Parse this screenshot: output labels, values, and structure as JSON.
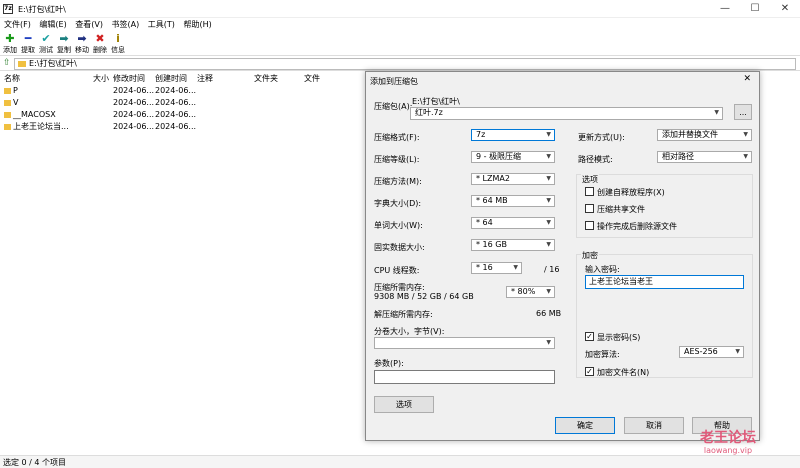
{
  "window": {
    "icon_text": "7z",
    "title": "E:\\打包\\红叶\\"
  },
  "menu": [
    "文件(F)",
    "编辑(E)",
    "查看(V)",
    "书签(A)",
    "工具(T)",
    "帮助(H)"
  ],
  "toolbar": {
    "add": "添加",
    "extract": "提取",
    "test": "测试",
    "copy": "复制",
    "move": "移动",
    "delete": "删除",
    "info": "信息"
  },
  "address": {
    "path": "E:\\打包\\红叶\\"
  },
  "columns": {
    "name": "名称",
    "size": "大小",
    "modified": "修改时间",
    "created": "创建时间",
    "comment": "注释",
    "folders": "文件夹",
    "files": "文件"
  },
  "files": [
    {
      "name": "P",
      "modified": "2024-06...",
      "created": "2024-06..."
    },
    {
      "name": "V",
      "modified": "2024-06...",
      "created": "2024-06..."
    },
    {
      "name": "__MACOSX",
      "modified": "2024-06...",
      "created": "2024-06..."
    },
    {
      "name": "上老王论坛当...",
      "modified": "2024-06...",
      "created": "2024-06..."
    }
  ],
  "status": {
    "text": "选定 0 / 4 个项目"
  },
  "dialog": {
    "title": "添加到压缩包",
    "archive_label": "压缩包(A):",
    "archive_dir": "E:\\打包\\红叶\\",
    "archive_name": "红叶.7z",
    "browse": "...",
    "format_label": "压缩格式(F):",
    "format": "7z",
    "level_label": "压缩等级(L):",
    "level": "9 - 极限压缩",
    "method_label": "压缩方法(M):",
    "method": "* LZMA2",
    "dict_label": "字典大小(D):",
    "dict": "* 64 MB",
    "word_label": "单词大小(W):",
    "word": "* 64",
    "solid_label": "固实数据大小:",
    "solid": "* 16 GB",
    "cpu_label": "CPU 线程数:",
    "cpu": "* 16",
    "cpu_max": "/ 16",
    "mem_label": "压缩所需内存:",
    "mem_detail": "9308 MB / 52 GB / 64 GB",
    "mem": "* 80%",
    "decomp_label": "解压缩所需内存:",
    "decomp_value": "66 MB",
    "split_label": "分卷大小，字节(V):",
    "params_label": "参数(P):",
    "options_btn": "选项",
    "update_label": "更新方式(U):",
    "update": "添加并替换文件",
    "pathmode_label": "路径模式:",
    "pathmode": "相对路径",
    "options_group": "选项",
    "opt_sfx": "创建自释放程序(X)",
    "opt_shared": "压缩共享文件",
    "opt_delete": "操作完成后删除源文件",
    "encrypt_group": "加密",
    "password_label": "输入密码:",
    "password": "上老王论坛当老王",
    "show_password": "显示密码(S)",
    "enc_method_label": "加密算法:",
    "enc_method": "AES-256",
    "encrypt_names": "加密文件名(N)",
    "check_mark": "✓",
    "ok": "确定",
    "cancel": "取消",
    "help": "帮助"
  },
  "watermark": {
    "line1": "老王论坛",
    "line2": "laowang.vip"
  }
}
